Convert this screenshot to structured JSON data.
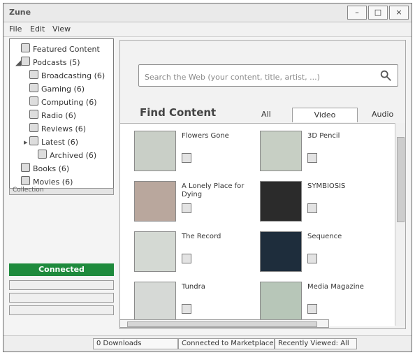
{
  "window": {
    "title": "Zune",
    "buttons": [
      "–",
      "□",
      "×"
    ]
  },
  "menu": [
    "File",
    "Edit",
    "View"
  ],
  "tree": [
    {
      "label": "Featured Content",
      "indent": 0,
      "twisty": "",
      "icon": "star-icon"
    },
    {
      "label": "Podcasts (5)",
      "indent": 0,
      "twisty": "◢",
      "icon": "podcast-icon"
    },
    {
      "label": "Broadcasting (6)",
      "indent": 1,
      "twisty": "",
      "icon": "broadcast-icon"
    },
    {
      "label": "Gaming (6)",
      "indent": 1,
      "twisty": "",
      "icon": "gamepad-icon"
    },
    {
      "label": "Computing (6)",
      "indent": 1,
      "twisty": "",
      "icon": "computer-icon"
    },
    {
      "label": "Radio (6)",
      "indent": 1,
      "twisty": "",
      "icon": "radio-icon"
    },
    {
      "label": "Reviews (6)",
      "indent": 1,
      "twisty": "",
      "icon": "review-icon"
    },
    {
      "label": "Latest (6)",
      "indent": 1,
      "twisty": "▸",
      "icon": "latest-icon"
    },
    {
      "label": "Archived (6)",
      "indent": 2,
      "twisty": "",
      "icon": "archive-icon"
    },
    {
      "label": "Books (6)",
      "indent": 0,
      "twisty": "",
      "icon": "book-icon"
    },
    {
      "label": "Movies (6)",
      "indent": 0,
      "twisty": "",
      "icon": "movie-icon"
    }
  ],
  "left_separator_label": "Collection",
  "status_green": "Connected",
  "search": {
    "placeholder": "Search the Web (your content, title, artist, ...)"
  },
  "section_title": "Find Content",
  "tabs": [
    "All",
    "Video",
    "Audio"
  ],
  "active_tab": "Video",
  "cards": [
    {
      "title": "Flowers Gone",
      "thumb_color": "#c9cfc7"
    },
    {
      "title": "3D Pencil",
      "thumb_color": "#c7cfc4"
    },
    {
      "title": "A Lonely Place for Dying",
      "thumb_color": "#b9a79d"
    },
    {
      "title": "SYMBIOSIS",
      "thumb_color": "#2b2b2b"
    },
    {
      "title": "The Record",
      "thumb_color": "#d4d9d3"
    },
    {
      "title": "Sequence",
      "thumb_color": "#1e2d3c"
    },
    {
      "title": "Tundra",
      "thumb_color": "#d6d9d6"
    },
    {
      "title": "Media Magazine",
      "thumb_color": "#b7c6b8"
    }
  ],
  "status": [
    {
      "label": "0 Downloads"
    },
    {
      "label": "Connected to Marketplace"
    },
    {
      "label": "Recently Viewed: All"
    }
  ]
}
